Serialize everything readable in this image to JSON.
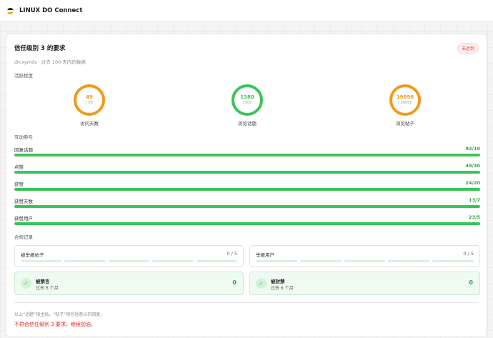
{
  "app": {
    "title": "LINUX DO Connect",
    "logo_colors": [
      "#1c1c1e",
      "#f0f0f0",
      "#f6a623"
    ]
  },
  "card": {
    "title": "信任级别 3 的要求",
    "status_badge": "未达到",
    "subtitle": "@cxymds · 过去 100 天内的数据"
  },
  "activity": {
    "section_label": "活跃程度",
    "metrics": [
      {
        "label": "访问天数",
        "value": "49",
        "target": "/ 50",
        "met": false
      },
      {
        "label": "浏览话题",
        "value": "1380",
        "target": "/ 500",
        "met": true
      },
      {
        "label": "浏览帖子",
        "value": "19696",
        "target": "/ 20000",
        "met": false
      }
    ]
  },
  "interaction": {
    "section_label": "互动参与",
    "rows": [
      {
        "label": "回复话题",
        "value": "92/10",
        "progress": 1.0
      },
      {
        "label": "点赞",
        "value": "49/30",
        "progress": 1.0
      },
      {
        "label": "获赞",
        "value": "24/20",
        "progress": 1.0
      },
      {
        "label": "获赞天数",
        "value": "13/7",
        "progress": 1.0
      },
      {
        "label": "获赞用户",
        "value": "23/5",
        "progress": 1.0
      }
    ]
  },
  "compliance": {
    "section_label": "合规记录",
    "counters": [
      {
        "label": "被举报帖子",
        "value": "0 / 5",
        "segments": 5,
        "filled": 0
      },
      {
        "label": "举报用户",
        "value": "0 / 5",
        "segments": 5,
        "filled": 0
      }
    ],
    "checks": [
      {
        "title": "被禁言",
        "sub": "过去 6 个月",
        "value": "0"
      },
      {
        "title": "被封禁",
        "sub": "过去 6 个月",
        "value": "0"
      }
    ]
  },
  "footer": {
    "note": "以上“话题”指主贴，“帖子”则包括意义的回复。",
    "verdict": "不符合信任级别 3 要求，继续加油。"
  },
  "colors": {
    "success": "#3cc45a",
    "warning": "#f29a1c",
    "danger": "#e0261c"
  }
}
